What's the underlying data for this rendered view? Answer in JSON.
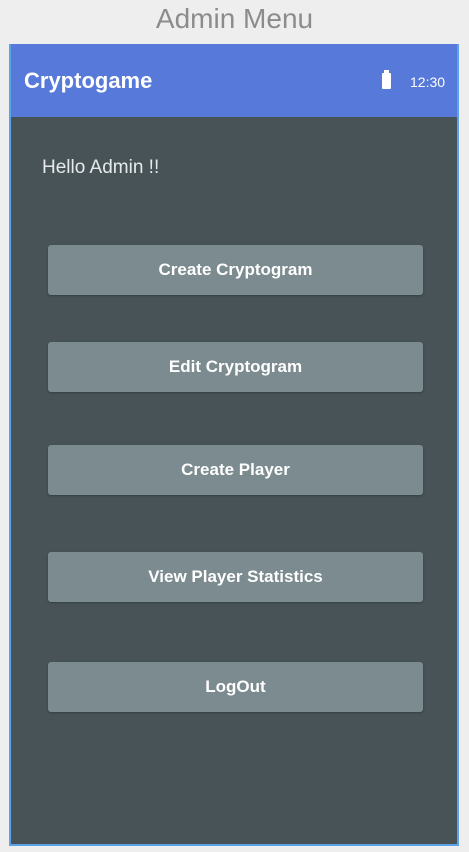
{
  "caption": "Admin Menu",
  "app_bar": {
    "title": "Cryptogame",
    "time": "12:30",
    "battery_icon": "battery-full-icon"
  },
  "greeting": "Hello Admin !!",
  "buttons": [
    {
      "label": "Create Cryptogram"
    },
    {
      "label": "Edit Cryptogram"
    },
    {
      "label": "Create Player"
    },
    {
      "label": "View Player Statistics"
    },
    {
      "label": "LogOut"
    }
  ],
  "colors": {
    "app_bar": "#5779d9",
    "background": "#475357",
    "button": "#7b8b8f",
    "frame_border": "#5aa3e8"
  }
}
